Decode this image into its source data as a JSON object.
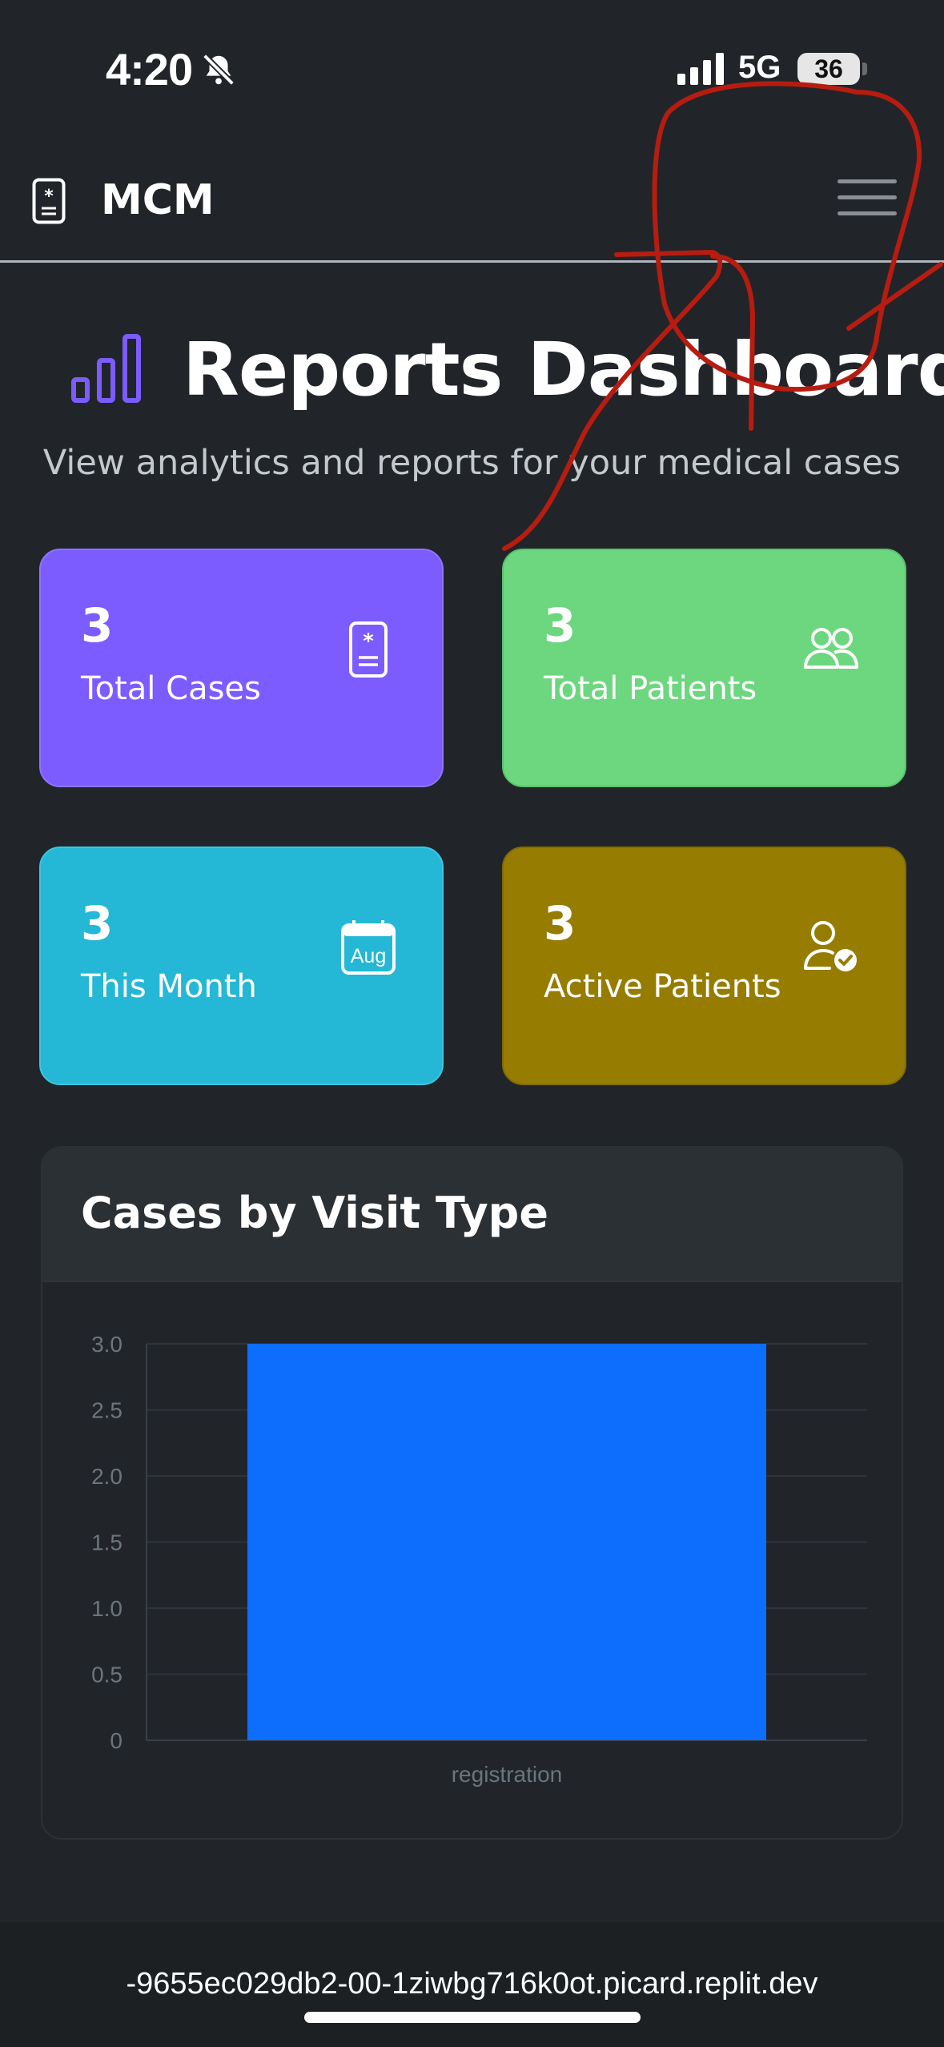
{
  "status_bar": {
    "time": "4:20",
    "network": "5G",
    "battery": "36"
  },
  "navbar": {
    "brand": "MCM"
  },
  "page": {
    "title": "Reports Dashboard",
    "subtitle": "View analytics and reports for your medical cases"
  },
  "stats": [
    {
      "value": "3",
      "label": "Total Cases",
      "icon": "medical-file-icon",
      "color": "#7c5cff"
    },
    {
      "value": "3",
      "label": "Total Patients",
      "icon": "people-icon",
      "color": "#6cd77e"
    },
    {
      "value": "3",
      "label": "This Month",
      "icon": "calendar-icon",
      "icon_text": "Aug",
      "color": "#24b8d6"
    },
    {
      "value": "3",
      "label": "Active Patients",
      "icon": "person-check-icon",
      "color": "#967c00"
    }
  ],
  "chart_card": {
    "title": "Cases by Visit Type"
  },
  "chart_data": {
    "type": "bar",
    "categories": [
      "registration"
    ],
    "values": [
      3
    ],
    "ylim": [
      0,
      3
    ],
    "yticks": [
      "0",
      "0.5",
      "1.0",
      "1.5",
      "2.0",
      "2.5",
      "3.0"
    ],
    "grid": true,
    "bar_color": "#0d6efd"
  },
  "url_bar": {
    "url": "-9655ec029db2-00-1ziwbg716k0ot.picard.replit.dev"
  }
}
